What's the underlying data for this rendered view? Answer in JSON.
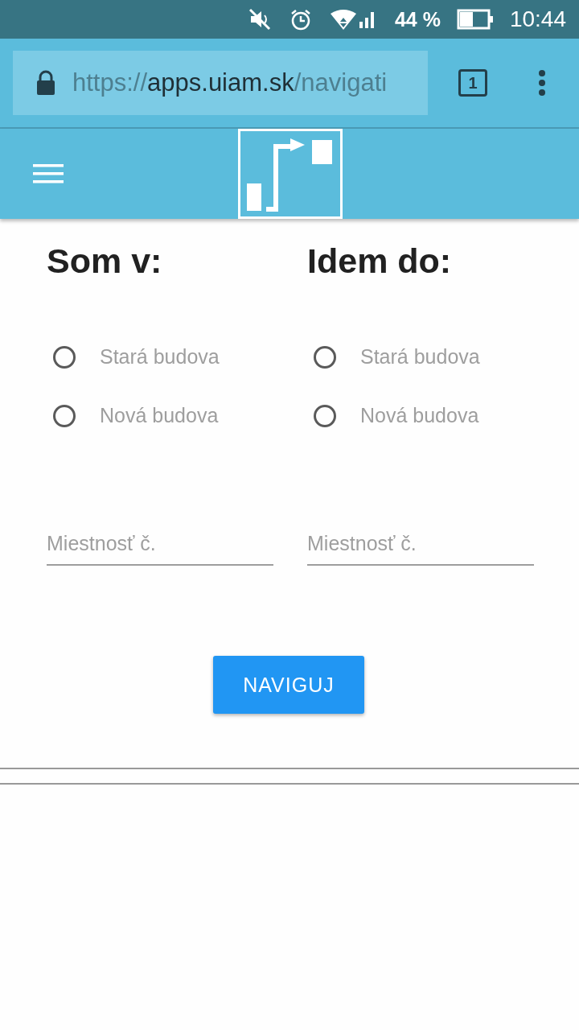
{
  "status_bar": {
    "battery_text": "44 %",
    "time": "10:44"
  },
  "browser": {
    "url_parts": [
      {
        "text": "https://",
        "kind": "dim"
      },
      {
        "text": "apps.uiam.sk",
        "kind": "host"
      },
      {
        "text": "/navigati",
        "kind": "dim"
      }
    ],
    "tab_count": "1"
  },
  "columns": [
    {
      "title": "Som v:",
      "options": [
        {
          "label": "Stará budova",
          "selected": false
        },
        {
          "label": "Nová budova",
          "selected": false
        }
      ],
      "room": {
        "placeholder": "Miestnosť č."
      }
    },
    {
      "title": "Idem do:",
      "options": [
        {
          "label": "Stará budova",
          "selected": false
        },
        {
          "label": "Nová budova",
          "selected": false
        }
      ],
      "room": {
        "placeholder": "Miestnosť č."
      }
    }
  ],
  "button": "NAVIGUJ"
}
